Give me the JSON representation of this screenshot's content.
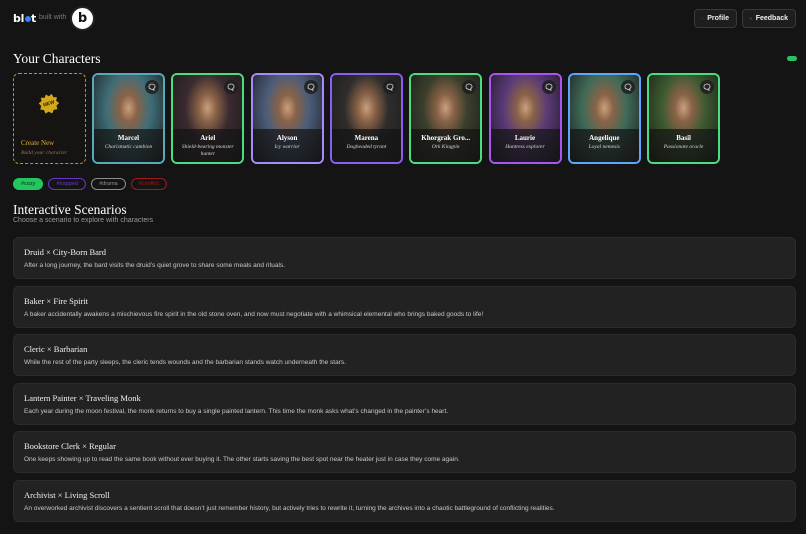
{
  "header": {
    "logo_text_left": "bl",
    "logo_text_right": "t",
    "built_with": "built with",
    "badge_letter": "b",
    "profile_label": "Profile",
    "feedback_label": "Feedback"
  },
  "characters": {
    "title": "Your Characters",
    "create": {
      "badge": "NEW",
      "title": "Create New",
      "subtitle": "Build your character"
    },
    "items": [
      {
        "name": "Marcel",
        "desc": "Charismatic cambion",
        "border": "#5aa9b8",
        "bg": "#3f6e78"
      },
      {
        "name": "Ariel",
        "desc": "Shield-bearing monster hunter",
        "border": "#4ade80",
        "bg": "#3a2a30"
      },
      {
        "name": "Alyson",
        "desc": "Icy warrior",
        "border": "#a78bfa",
        "bg": "#4b5d7a"
      },
      {
        "name": "Marena",
        "desc": "Dogheaded tyrant",
        "border": "#8b5cf6",
        "bg": "#2e2d2c"
      },
      {
        "name": "Khorgrak Gro...",
        "desc": "Ork Kingpin",
        "border": "#4ade80",
        "bg": "#3a3f2c"
      },
      {
        "name": "Laurie",
        "desc": "Huntress explorer",
        "border": "#a855f7",
        "bg": "#5a3a78"
      },
      {
        "name": "Angelique",
        "desc": "Loyal nemesis",
        "border": "#60a5fa",
        "bg": "#3f6b58"
      },
      {
        "name": "Basil",
        "desc": "Passionate oracle",
        "border": "#4ade80",
        "bg": "#3d5a30"
      }
    ],
    "accent": "#22c55e"
  },
  "tags": [
    {
      "label": "#cozy",
      "color": "#22c55e",
      "active": true
    },
    {
      "label": "#trapped",
      "color": "#7c3aed",
      "active": false
    },
    {
      "label": "#drama",
      "color": "#a3a3a3",
      "active": false
    },
    {
      "label": "#conflict",
      "color": "#b91c1c",
      "active": false
    }
  ],
  "scenarios": {
    "title": "Interactive Scenarios",
    "subtitle": "Choose a scenario to explore with characters",
    "items": [
      {
        "title": "Druid × City-Born Bard",
        "desc": "After a long journey, the bard visits the druid’s quiet grove to share some meals and rituals."
      },
      {
        "title": "Baker × Fire Spirit",
        "desc": "A baker accidentally awakens a mischievous fire spirit in the old stone oven, and now must negotiate with a whimsical elemental who brings baked goods to life!"
      },
      {
        "title": "Cleric × Barbarian",
        "desc": "While the rest of the party sleeps, the cleric tends wounds and the barbarian stands watch underneath the stars."
      },
      {
        "title": "Lantern Painter × Traveling Monk",
        "desc": "Each year during the moon festival, the monk returns to buy a single painted lantern. This time the monk asks what’s changed in the painter’s heart."
      },
      {
        "title": "Bookstore Clerk × Regular",
        "desc": "One keeps showing up to read the same book without ever buying it. The other starts saving the best spot near the heater just in case they come again."
      },
      {
        "title": "Archivist × Living Scroll",
        "desc": "An overworked archivist discovers a sentient scroll that doesn’t just remember history, but actively tries to rewrite it, turning the archives into a chaotic battleground of conflicting realities."
      }
    ]
  }
}
